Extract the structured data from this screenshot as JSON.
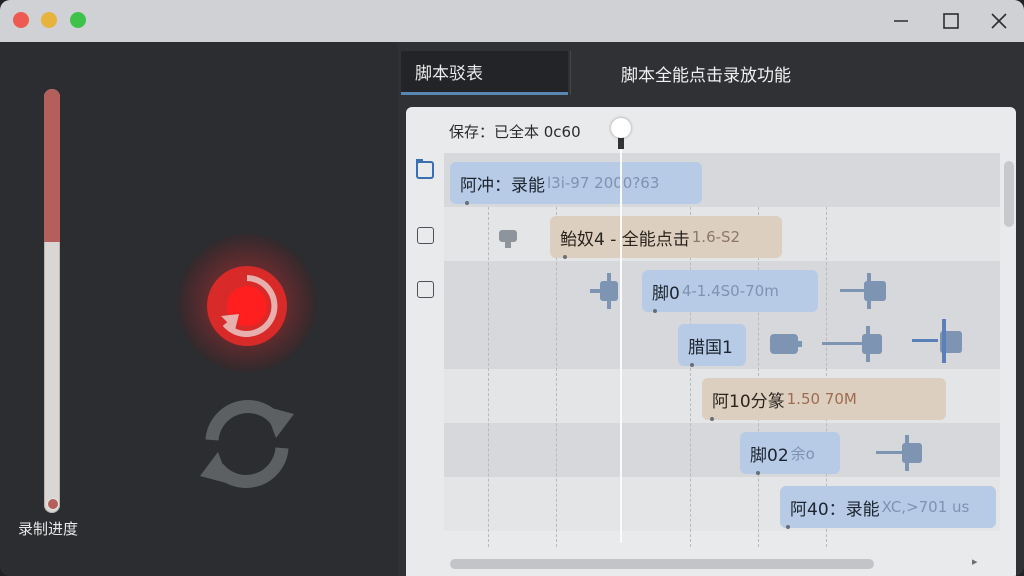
{
  "window": {
    "traffic_lights": {
      "close": "#ee5a52",
      "minimize": "#e7b33c",
      "zoom": "#3fc24c"
    }
  },
  "left_panel": {
    "progress_label": "录制进度",
    "progress_fraction": 0.36,
    "progress_color": "#b55f5c",
    "record_icon": "record-refresh-icon",
    "sync_icon": "sync-arrows-icon"
  },
  "tabs": [
    {
      "label": "脚本驳表",
      "active": true
    },
    {
      "label": "脚本全能点击录放功能",
      "active": false
    }
  ],
  "timeline": {
    "status": "保存：已全本 0c60",
    "blocks": [
      {
        "main": "阿冲：录能",
        "dim": "l3i-97 2000?63",
        "color": "blue"
      },
      {
        "main": "鲐奴4 - 全能点击",
        "dim": "1.6-S2",
        "color": "tan"
      },
      {
        "main": "脚0",
        "dim": "4-1.4S0-70m",
        "color": "blue"
      },
      {
        "main": "腊国1",
        "dim": "",
        "color": "blue"
      },
      {
        "main": "阿10分篆",
        "dim": "1.50 70M",
        "color": "tan"
      },
      {
        "main": "脚02",
        "dim": "余o",
        "color": "blue"
      },
      {
        "main": "阿40：录能",
        "dim": "XC,>701 us",
        "color": "blue"
      }
    ],
    "accent_blue": "#b7cbe6",
    "accent_tan": "#ddcfbf"
  }
}
